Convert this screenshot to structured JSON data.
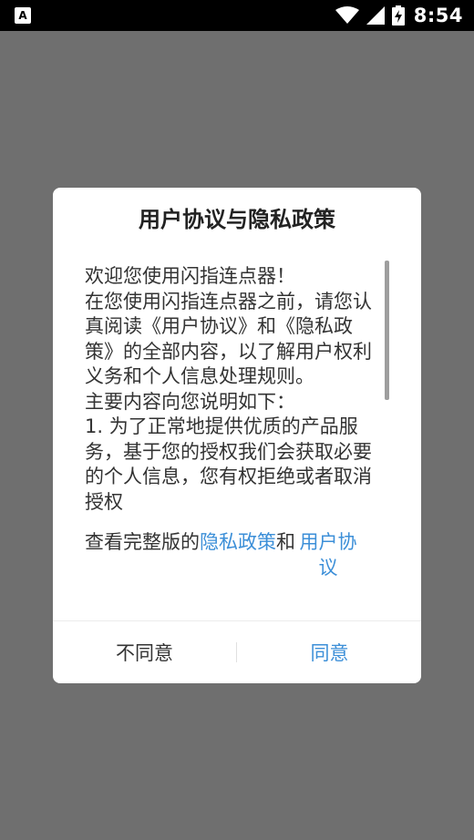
{
  "status_bar": {
    "time": "8:54",
    "app_icon": "A",
    "icons": [
      "wifi-icon",
      "signal-icon",
      "battery-charging-icon"
    ]
  },
  "dialog": {
    "title": "用户协议与隐私政策",
    "body_lines": [
      "欢迎您使用闪指连点器！",
      "在您使用闪指连点器之前，请您认真阅读《用户协议》和《隐私政策》的全部内容，以了解用户权利义务和个人信息处理规则。",
      "主要内容向您说明如下：",
      "1. 为了正常地提供优质的产品服务，基于您的授权我们会获取必要的个人信息，您有权拒绝或者取消授权"
    ],
    "view_full_prefix": "查看完整版的",
    "privacy_link": "隐私政策",
    "conjunction": "和",
    "user_agreement_link": "用户协议",
    "disagree_label": "不同意",
    "agree_label": "同意"
  },
  "colors": {
    "overlay": "#6f6f6f",
    "link": "#3c8fd8",
    "text": "#333333"
  }
}
